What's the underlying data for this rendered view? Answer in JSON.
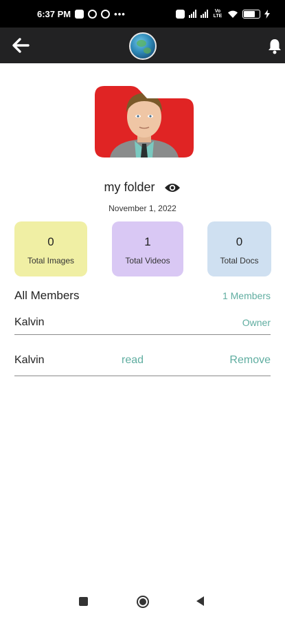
{
  "status_bar": {
    "time": "6:37 PM",
    "dots": "•••",
    "volte": "Vo LTE",
    "battery": "55"
  },
  "app_bar": {
    "back_icon": "arrow-left-icon",
    "logo_icon": "globe-logo",
    "bell_icon": "bell-icon"
  },
  "folder": {
    "name": "my folder",
    "date": "November 1, 2022",
    "cover_colors": {
      "background": "#e02424",
      "skin": "#efc6a5",
      "hair": "#7a5a2a",
      "suit": "#8a8c8c",
      "shirt": "#7ac9c0"
    }
  },
  "stats": [
    {
      "value": "0",
      "label": "Total Images",
      "color": "#f0efa4"
    },
    {
      "value": "1",
      "label": "Total Videos",
      "color": "#d9c8f4"
    },
    {
      "value": "0",
      "label": "Total Docs",
      "color": "#cfe0f1"
    }
  ],
  "members": {
    "title": "All Members",
    "count": "1 Members",
    "owner": {
      "name": "Kalvin",
      "role": "Owner"
    },
    "list": [
      {
        "name": "Kalvin",
        "permission": "read",
        "action": "Remove"
      }
    ]
  },
  "accent_color": "#5fada0"
}
